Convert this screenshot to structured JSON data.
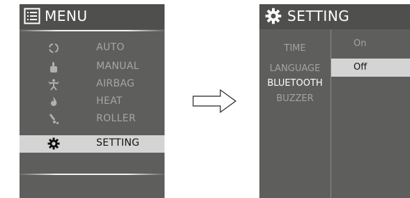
{
  "menu_screen": {
    "title": "MENU",
    "title_icon": "menu-list-icon",
    "items": [
      {
        "label": "AUTO",
        "icon": "auto-cycle-icon"
      },
      {
        "label": "MANUAL",
        "icon": "hand-icon"
      },
      {
        "label": "AIRBAG",
        "icon": "airbag-person-icon"
      },
      {
        "label": "HEAT",
        "icon": "flame-icon"
      },
      {
        "label": "ROLLER",
        "icon": "roller-icon"
      },
      {
        "label": "SETTING",
        "icon": "gear-icon",
        "selected": true
      }
    ]
  },
  "setting_screen": {
    "title": "SETTING",
    "title_icon": "gear-icon",
    "items": [
      {
        "label": "TIME"
      },
      {
        "label": "LANGUAGE"
      },
      {
        "label": "BLUETOOTH",
        "selected": true
      },
      {
        "label": "BUZZER"
      }
    ],
    "options": [
      {
        "label": "On"
      },
      {
        "label": "Off",
        "selected": true
      }
    ]
  },
  "transition_icon": "right-arrow-icon",
  "colors": {
    "screen_bg": "#5e5e5c",
    "header_bg": "#4f4f4d",
    "highlight": "#d4d4d4",
    "inactive_text": "#a6a6a6",
    "active_text": "#ffffff"
  }
}
